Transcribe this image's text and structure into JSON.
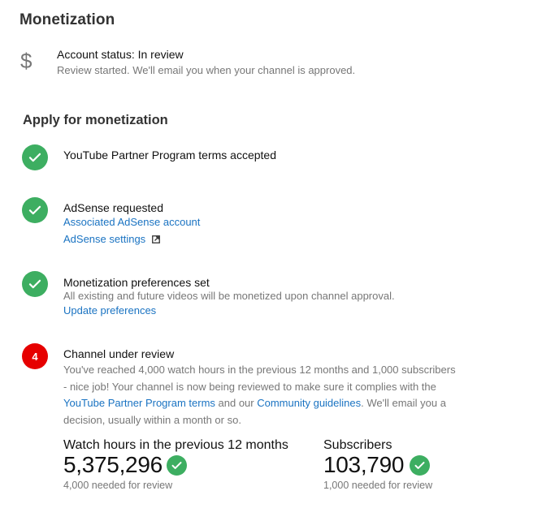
{
  "header": {
    "title": "Monetization"
  },
  "account": {
    "icon": "dollar-icon",
    "status": "Account status: In review",
    "note": "Review started. We'll email you when your channel is approved."
  },
  "apply": {
    "title": "Apply for monetization",
    "steps": [
      {
        "state": "done",
        "icon": "check-icon",
        "title": "YouTube Partner Program terms accepted"
      },
      {
        "state": "done",
        "icon": "check-icon",
        "title": "AdSense requested",
        "links": [
          "Associated AdSense account",
          "AdSense settings"
        ],
        "external_icon": "external-link-icon"
      },
      {
        "state": "done",
        "icon": "check-icon",
        "title": "Monetization preferences set",
        "text": "All existing and future videos will be monetized upon channel approval.",
        "link": "Update preferences"
      },
      {
        "state": "current",
        "number": "4",
        "title": "Channel under review",
        "text_1": "You've reached 4,000 watch hours in the previous 12 months and 1,000 subscribers - nice job! Your channel is now being reviewed to make sure it complies with the ",
        "link_terms": "YouTube Partner Program terms",
        "text_2": " and our ",
        "link_guidelines": "Community guidelines",
        "text_3": ". We'll email you a decision, usually within a month or so."
      }
    ]
  },
  "stats": {
    "watch_hours": {
      "label": "Watch hours in the previous 12 months",
      "value": "5,375,296",
      "note": "4,000 needed for review",
      "icon": "check-icon"
    },
    "subscribers": {
      "label": "Subscribers",
      "value": "103,790",
      "note": "1,000 needed for review",
      "icon": "check-icon"
    }
  },
  "colors": {
    "success": "#3dae61",
    "alert": "#e60000",
    "link": "#1a73c2",
    "muted": "#777777"
  }
}
